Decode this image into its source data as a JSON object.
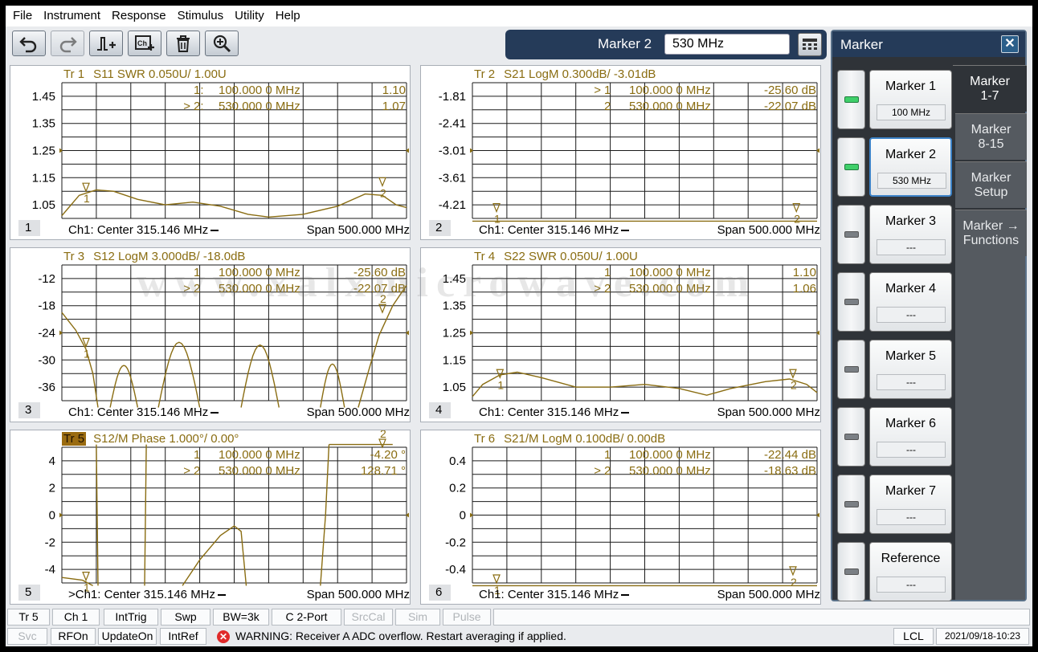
{
  "menu": [
    "File",
    "Instrument",
    "Response",
    "Stimulus",
    "Utility",
    "Help"
  ],
  "entry": {
    "label": "Marker 2",
    "value": "530 MHz"
  },
  "traces": [
    {
      "id": 1,
      "name": "Tr 1",
      "desc": "S11 SWR 0.050U/  1.00U",
      "active": false,
      "num": "1",
      "yticks": [
        "1.45",
        "1.35",
        "1.25",
        "1.15",
        "1.05"
      ],
      "markers": [
        {
          "sel": "",
          "num": "1:",
          "freq": "100.000 0 MHz",
          "val": "1.10"
        },
        {
          "sel": ">",
          "num": "2:",
          "freq": "530.000 0 MHz",
          "val": "1.07"
        }
      ],
      "footer_center": "Ch1:  Center   315.146 MHz",
      "footer_span": "Span  500.000 MHz",
      "plot_markers": [
        {
          "label": "1"
        },
        {
          "label": "2"
        }
      ]
    },
    {
      "id": 2,
      "name": "Tr  2",
      "desc": "S21 LogM 0.300dB/  -3.01dB",
      "active": false,
      "num": "2",
      "yticks": [
        "-1.81",
        "-2.41",
        "-3.01",
        "-3.61",
        "-4.21"
      ],
      "markers": [
        {
          "sel": ">",
          "num": "1",
          "freq": "100.000 0 MHz",
          "val": "-25.60 dB"
        },
        {
          "sel": "",
          "num": "2",
          "freq": "530.000 0 MHz",
          "val": "-22.07 dB"
        }
      ],
      "footer_center": "Ch1:  Center   315.146 MHz",
      "footer_span": "Span  500.000 MHz",
      "plot_markers": [
        {
          "label": "1"
        },
        {
          "label": "2"
        }
      ]
    },
    {
      "id": 3,
      "name": "Tr  3",
      "desc": "S12 LogM 3.000dB/  -18.0dB",
      "active": false,
      "num": "3",
      "yticks": [
        "-12",
        "-18",
        "-24",
        "-30",
        "-36"
      ],
      "markers": [
        {
          "sel": "",
          "num": "1",
          "freq": "100.000 0 MHz",
          "val": "-25.60 dB"
        },
        {
          "sel": ">",
          "num": "2",
          "freq": "530.000 0 MHz",
          "val": "-22.07 dB"
        }
      ],
      "footer_center": "Ch1:  Center   315.146 MHz",
      "footer_span": "Span  500.000 MHz",
      "plot_markers": [
        {
          "label": "1"
        },
        {
          "label": "2"
        }
      ]
    },
    {
      "id": 4,
      "name": "Tr  4",
      "desc": "S22 SWR 0.050U/  1.00U",
      "active": false,
      "num": "4",
      "yticks": [
        "1.45",
        "1.35",
        "1.25",
        "1.15",
        "1.05"
      ],
      "markers": [
        {
          "sel": "",
          "num": "1",
          "freq": "100.000 0 MHz",
          "val": "1.10"
        },
        {
          "sel": ">",
          "num": "2",
          "freq": "530.000 0 MHz",
          "val": "1.06"
        }
      ],
      "footer_center": "Ch1:  Center   315.146 MHz",
      "footer_span": "Span  500.000 MHz",
      "plot_markers": [
        {
          "label": "1"
        },
        {
          "label": "2"
        }
      ]
    },
    {
      "id": 5,
      "name": "Tr  5",
      "desc": "S12/M Phase 1.000°/  0.00°",
      "active": true,
      "num": "5",
      "yticks": [
        "4",
        "2",
        "0",
        "-2",
        "-4"
      ],
      "markers": [
        {
          "sel": "",
          "num": "1",
          "freq": "100.000 0 MHz",
          "val": "-4.20 °"
        },
        {
          "sel": ">",
          "num": "2",
          "freq": "530.000 0 MHz",
          "val": "128.71 °"
        }
      ],
      "footer_center": ">Ch1:  Center   315.146 MHz",
      "footer_span": "Span  500.000 MHz",
      "plot_markers": [
        {
          "label": "1"
        },
        {
          "label": "2"
        }
      ]
    },
    {
      "id": 6,
      "name": "Tr  6",
      "desc": "S21/M LogM 0.100dB/  0.00dB",
      "active": false,
      "num": "6",
      "yticks": [
        "0.4",
        "0.2",
        "0",
        "-0.2",
        "-0.4"
      ],
      "markers": [
        {
          "sel": "",
          "num": "1",
          "freq": "100.000 0 MHz",
          "val": "-22.44 dB"
        },
        {
          "sel": ">",
          "num": "2",
          "freq": "530.000 0 MHz",
          "val": "-18.63 dB"
        }
      ],
      "footer_center": "Ch1:  Center   315.146 MHz",
      "footer_span": "Span  500.000 MHz",
      "plot_markers": [
        {
          "label": "1"
        },
        {
          "label": "2"
        }
      ]
    }
  ],
  "marker_panel": {
    "title": "Marker",
    "markers": [
      {
        "label": "Marker 1",
        "value": "100 MHz",
        "on": true,
        "selected": false
      },
      {
        "label": "Marker 2",
        "value": "530 MHz",
        "on": true,
        "selected": true
      },
      {
        "label": "Marker 3",
        "value": "---",
        "on": false,
        "selected": false
      },
      {
        "label": "Marker 4",
        "value": "---",
        "on": false,
        "selected": false
      },
      {
        "label": "Marker 5",
        "value": "---",
        "on": false,
        "selected": false
      },
      {
        "label": "Marker 6",
        "value": "---",
        "on": false,
        "selected": false
      },
      {
        "label": "Marker 7",
        "value": "---",
        "on": false,
        "selected": false
      },
      {
        "label": "Reference",
        "value": "---",
        "on": false,
        "selected": false
      }
    ],
    "tabs": [
      {
        "label": "Marker\n1-7",
        "active": true
      },
      {
        "label": "Marker\n8-15",
        "active": false
      },
      {
        "label": "Marker\nSetup",
        "active": false
      },
      {
        "label": "Marker →\nFunctions",
        "active": false
      }
    ]
  },
  "status1": [
    {
      "text": "Tr 5",
      "dim": false
    },
    {
      "text": "Ch 1",
      "dim": false
    },
    {
      "text": "IntTrig",
      "dim": false
    },
    {
      "text": "Swp",
      "dim": false
    },
    {
      "text": "BW=3k",
      "dim": false
    },
    {
      "text": "C  2-Port",
      "dim": false
    },
    {
      "text": "SrcCal",
      "dim": true
    },
    {
      "text": "Sim",
      "dim": true
    },
    {
      "text": "Pulse",
      "dim": true
    }
  ],
  "status2": {
    "cells": [
      {
        "text": "Svc",
        "dim": true
      },
      {
        "text": "RFOn",
        "dim": false
      },
      {
        "text": "UpdateOn",
        "dim": false
      },
      {
        "text": "IntRef",
        "dim": false
      }
    ],
    "warning": "WARNING: Receiver A ADC overflow. Restart averaging if applied.",
    "lcl": "LCL",
    "datetime": "2021/09/18-10:23"
  },
  "watermark": "www.xalxmicrowave.com",
  "colors": {
    "trace": "#8a6d12",
    "header": "#253b59",
    "panel": "#2f3338",
    "led_on": "#3fcf6a"
  }
}
